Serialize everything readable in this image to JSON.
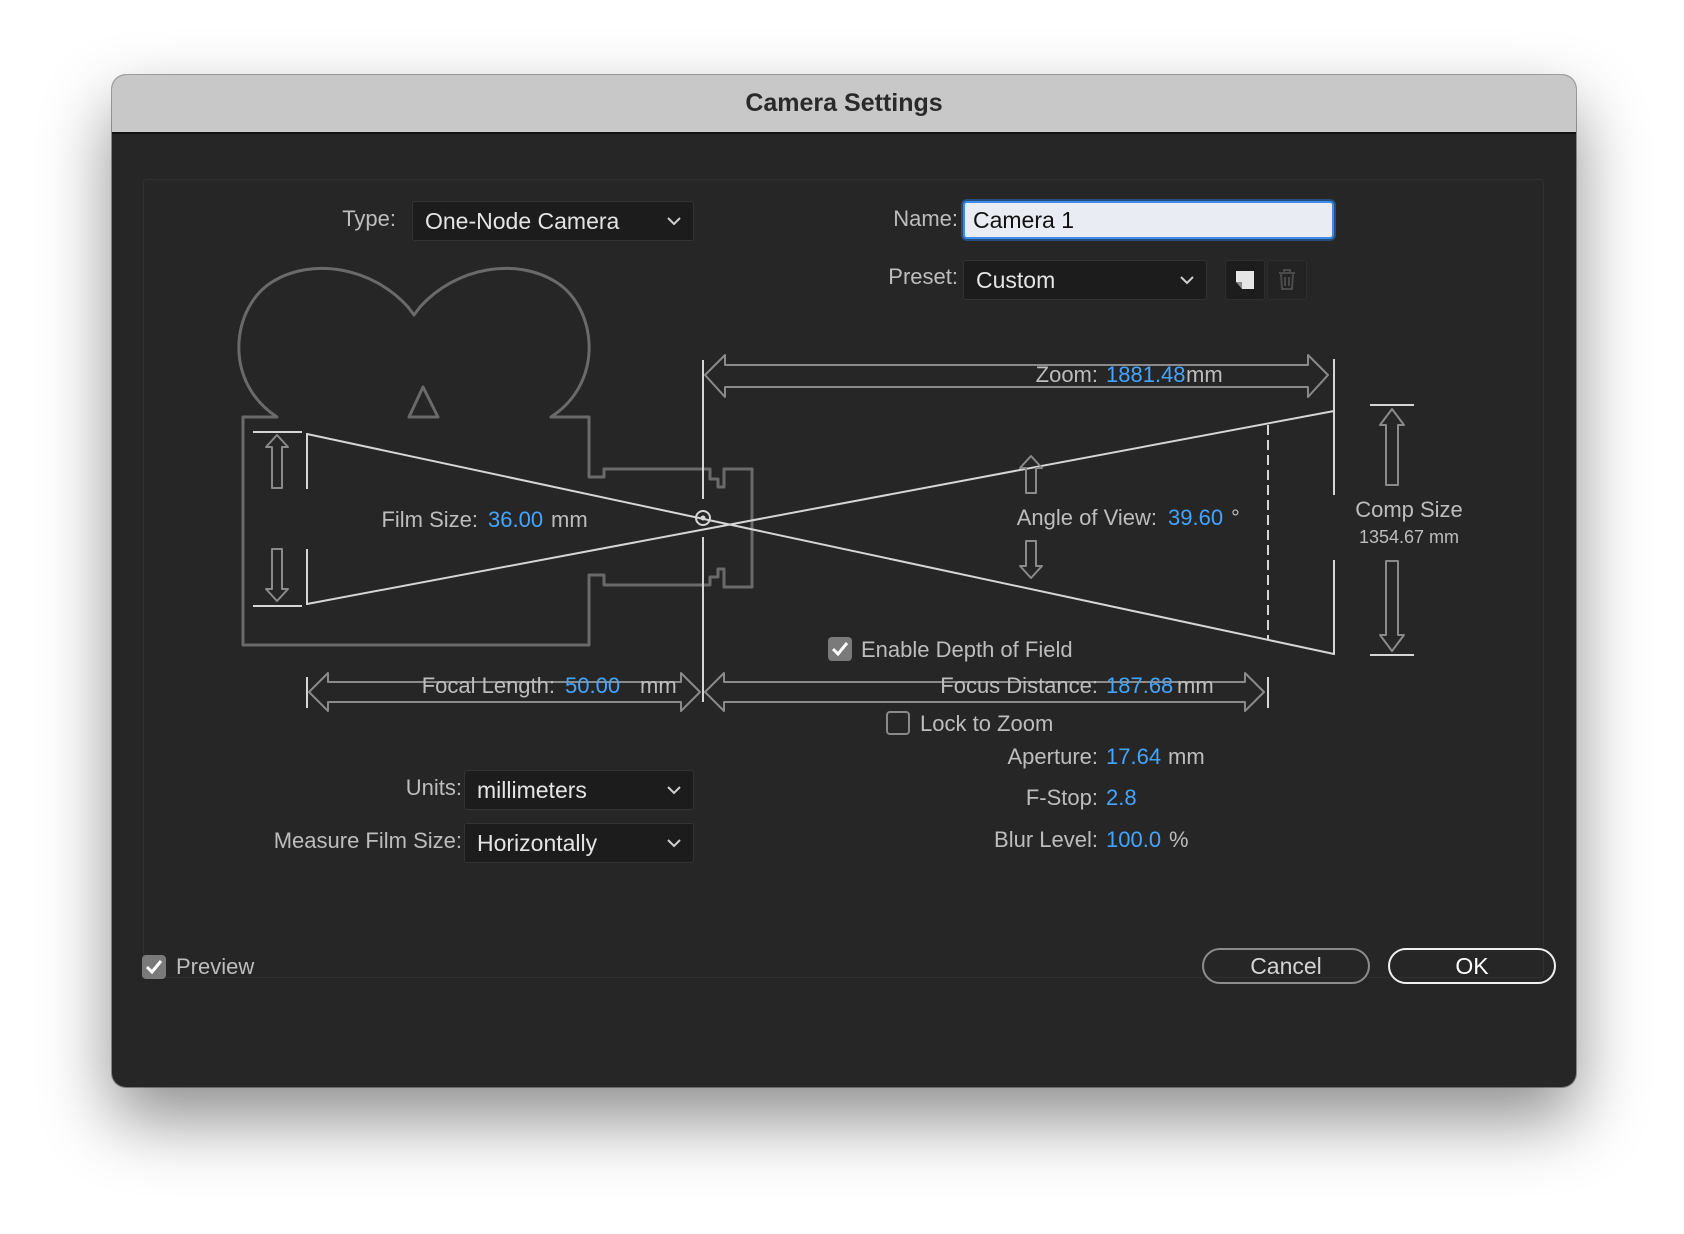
{
  "window": {
    "title": "Camera Settings"
  },
  "type": {
    "label": "Type:",
    "value": "One-Node Camera"
  },
  "name": {
    "label": "Name:",
    "value": "Camera 1"
  },
  "preset": {
    "label": "Preset:",
    "value": "Custom"
  },
  "icons": {
    "save_preset": "save-preset-icon",
    "delete_preset": "trash-icon",
    "dropdown": "chevron-down-icon"
  },
  "diagram": {
    "zoom": {
      "label": "Zoom:",
      "value": "1881.48",
      "unit": "mm"
    },
    "film_size": {
      "label": "Film Size:",
      "value": "36.00",
      "unit": "mm"
    },
    "angle_of_view": {
      "label": "Angle of View:",
      "value": "39.60",
      "unit": "°"
    },
    "comp_size": {
      "label": "Comp Size",
      "value": "1354.67 mm"
    },
    "focal_length": {
      "label": "Focal Length:",
      "value": "50.00",
      "unit": "mm"
    },
    "focus_distance": {
      "label": "Focus Distance:",
      "value": "187.68",
      "unit": "mm"
    }
  },
  "depth_of_field": {
    "enable_label": "Enable Depth of Field",
    "enabled": true,
    "lock_label": "Lock to Zoom",
    "locked": false,
    "aperture": {
      "label": "Aperture:",
      "value": "17.64",
      "unit": "mm"
    },
    "fstop": {
      "label": "F-Stop:",
      "value": "2.8"
    },
    "blur": {
      "label": "Blur Level:",
      "value": "100.0",
      "unit": "%"
    }
  },
  "units": {
    "label": "Units:",
    "value": "millimeters"
  },
  "measure_film_size": {
    "label": "Measure Film Size:",
    "value": "Horizontally"
  },
  "footer": {
    "preview_label": "Preview",
    "preview_checked": true,
    "cancel_label": "Cancel",
    "ok_label": "OK"
  },
  "colors": {
    "accent": "#43a5ff",
    "background": "#262626",
    "titlebar": "#c8c8c8"
  }
}
